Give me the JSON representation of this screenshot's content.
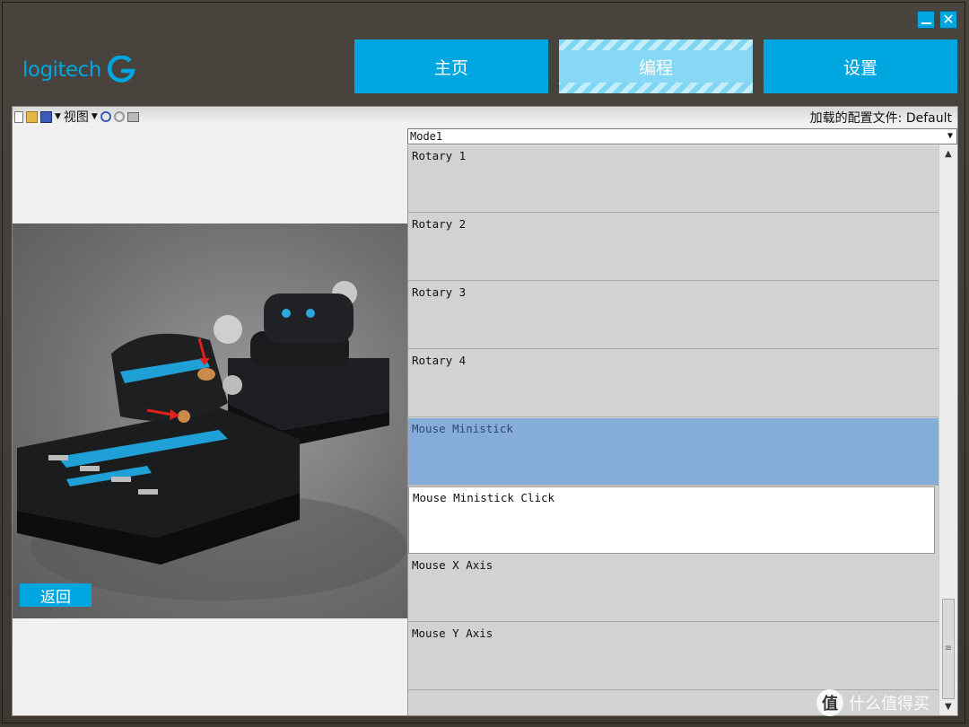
{
  "brand": {
    "logo_text": "logitech",
    "accent": "#00a6e0"
  },
  "window": {
    "minimize_icon": "minimize-icon",
    "close_icon": "close-icon",
    "close_glyph": "✕"
  },
  "nav": {
    "tabs": [
      {
        "label": "主页",
        "active": false
      },
      {
        "label": "编程",
        "active": true
      },
      {
        "label": "设置",
        "active": false
      }
    ]
  },
  "toolbar": {
    "view_label": "视图",
    "profile_label": "加载的配置文件: Default"
  },
  "product": {
    "back_label": "返回"
  },
  "mode_select": {
    "value": "Mode1"
  },
  "list": {
    "items": [
      {
        "label": "Rotary 1",
        "state": "normal"
      },
      {
        "label": "Rotary 2",
        "state": "normal"
      },
      {
        "label": "Rotary 3",
        "state": "normal"
      },
      {
        "label": "Rotary 4",
        "state": "normal"
      },
      {
        "label": "Mouse Ministick",
        "state": "selected"
      },
      {
        "label": "Mouse Ministick Click",
        "state": "focused"
      },
      {
        "label": "Mouse X Axis",
        "state": "normal"
      },
      {
        "label": "Mouse Y Axis",
        "state": "normal"
      }
    ]
  },
  "watermark": {
    "badge": "值",
    "text": "什么值得买"
  }
}
